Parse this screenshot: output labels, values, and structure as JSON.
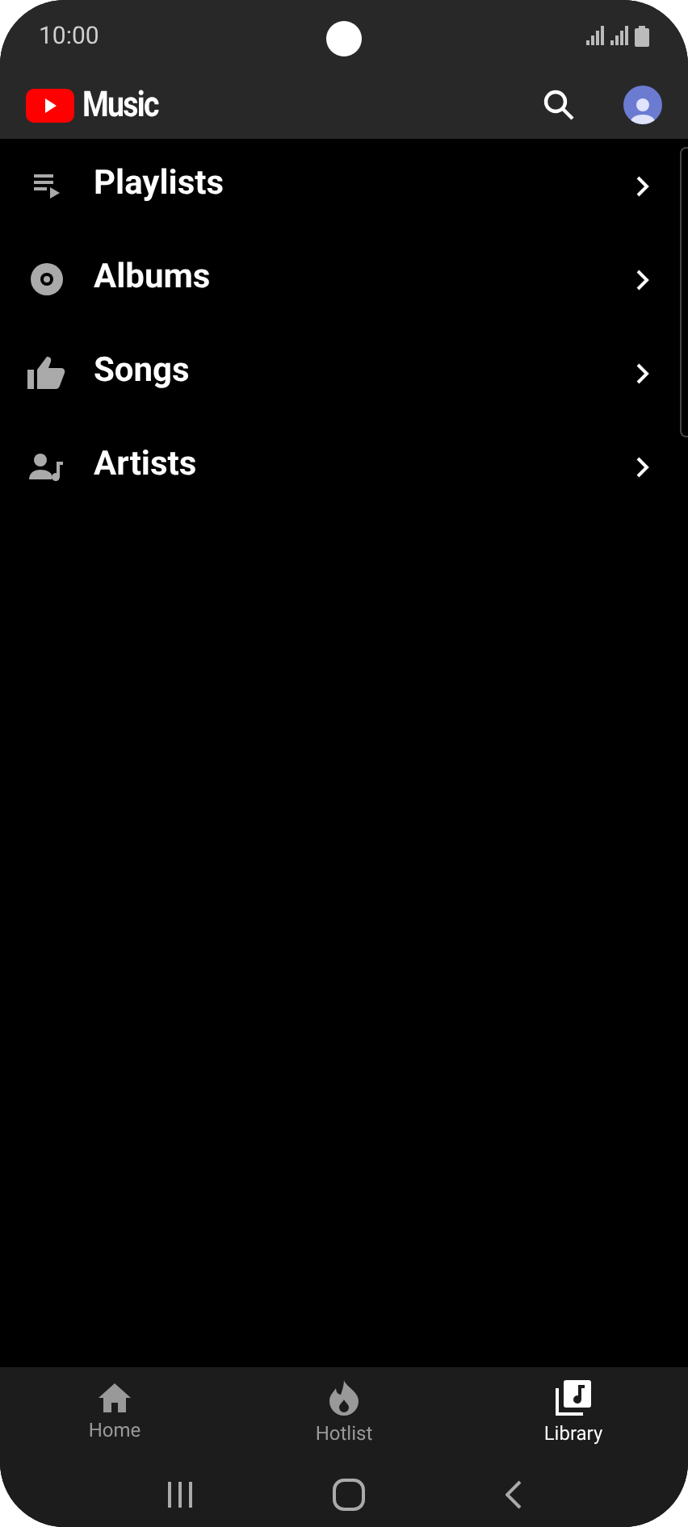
{
  "status_bar": {
    "time": "10:00"
  },
  "header": {
    "logo_text": "Music"
  },
  "library_items": [
    {
      "label": "Playlists",
      "kind": "playlist"
    },
    {
      "label": "Albums",
      "kind": "album"
    },
    {
      "label": "Songs",
      "kind": "like"
    },
    {
      "label": "Artists",
      "kind": "artist"
    }
  ],
  "bottom_nav": [
    {
      "label": "Home",
      "kind": "home",
      "selected": false
    },
    {
      "label": "Hotlist",
      "kind": "hotlist",
      "selected": false
    },
    {
      "label": "Library",
      "kind": "library",
      "selected": true
    }
  ]
}
